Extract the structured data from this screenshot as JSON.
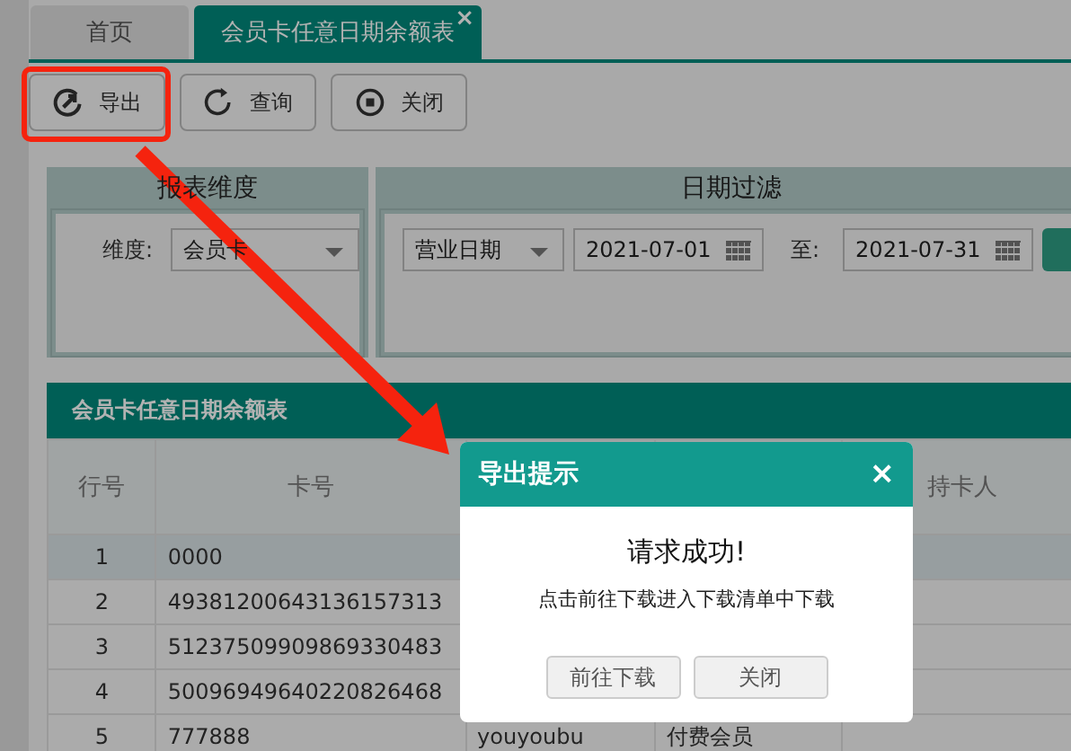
{
  "tabs": [
    {
      "label": "首页",
      "selected": false
    },
    {
      "label": "会员卡任意日期余额表",
      "selected": true,
      "close": "×"
    }
  ],
  "toolbar": [
    {
      "label": "导出",
      "highlighted": true
    },
    {
      "label": "查询",
      "highlighted": false
    },
    {
      "label": "关闭",
      "highlighted": false
    }
  ],
  "filters": {
    "dimension": {
      "title": "报表维度",
      "label": "维度:",
      "value": "会员卡"
    },
    "date": {
      "title": "日期过滤",
      "type_value": "营业日期",
      "from": "2021-07-01",
      "to_label": "至:",
      "to": "2021-07-31"
    }
  },
  "table": {
    "title": "会员卡任意日期余额表",
    "columns": [
      "行号",
      "卡号",
      null,
      null,
      "持卡人",
      null
    ],
    "rows": [
      {
        "selected": true,
        "cells": [
          "1",
          "0000",
          null,
          null,
          null,
          null
        ]
      },
      {
        "selected": false,
        "cells": [
          "2",
          "49381200643136157313",
          null,
          null,
          null,
          null
        ]
      },
      {
        "selected": false,
        "cells": [
          "3",
          "51237509909869330483",
          null,
          null,
          null,
          null
        ]
      },
      {
        "selected": false,
        "cells": [
          "4",
          "50096949640220826468",
          null,
          null,
          null,
          null
        ]
      },
      {
        "selected": false,
        "cells": [
          "5",
          "777888",
          "youyoubu",
          "付费会员",
          null,
          null
        ]
      }
    ]
  },
  "dialog": {
    "title": "导出提示",
    "close": "×",
    "heading": "请求成功!",
    "message": "点击前往下载进入下载清单中下载",
    "buttons": [
      "前往下载",
      "关闭"
    ]
  }
}
